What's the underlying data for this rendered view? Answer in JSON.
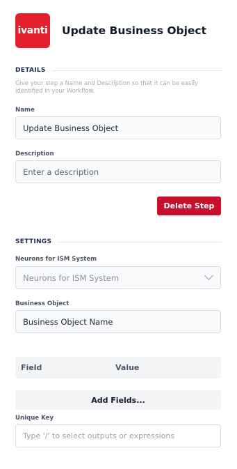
{
  "header": {
    "logo_text": "ivanti",
    "title": "Update Business Object"
  },
  "details": {
    "section_title": "DETAILS",
    "help_text": "Give your step a Name and Description so that it can be easily identified in your Workflow.",
    "name_label": "Name",
    "name_value": "Update Business Object",
    "description_label": "Description",
    "description_placeholder": "Enter a description",
    "delete_label": "Delete Step"
  },
  "settings": {
    "section_title": "SETTINGS",
    "system_label": "Neurons for ISM System",
    "system_value": "Neurons for ISM System",
    "business_object_label": "Business Object",
    "business_object_value": "Business Object Name",
    "table_headers": [
      "Field",
      "Value"
    ],
    "add_fields_label": "Add Fields...",
    "unique_key_label": "Unique Key",
    "unique_key_placeholder": "Type '/' to select outputs or expressions"
  },
  "colors": {
    "brand": "#e4202e",
    "danger_button": "#c8102e"
  },
  "icons": {
    "dropdown": "chevron-down-icon"
  }
}
